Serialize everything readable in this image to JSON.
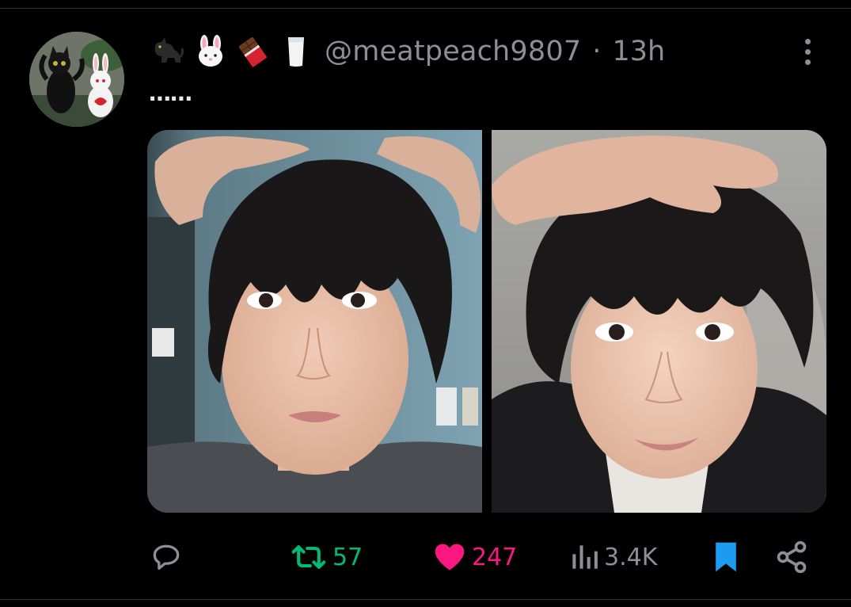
{
  "tweet": {
    "author_emojis": [
      "black-cat-emoji",
      "rabbit-face-emoji",
      "chocolate-bar-emoji",
      "milk-glass-emoji"
    ],
    "handle": "@meatpeach9807",
    "separator": "·",
    "timestamp": "13h",
    "text": "⋯⋯",
    "media_count": 2
  },
  "actions": {
    "reply_count": "",
    "retweet_count": "57",
    "like_count": "247",
    "view_count": "3.4K"
  },
  "colors": {
    "background": "#000000",
    "muted_text": "#8b9096",
    "retweet_active": "#00ba7c",
    "like_active": "#f91880",
    "bookmark_active": "#1d9bf0",
    "divider": "#2f3336"
  }
}
